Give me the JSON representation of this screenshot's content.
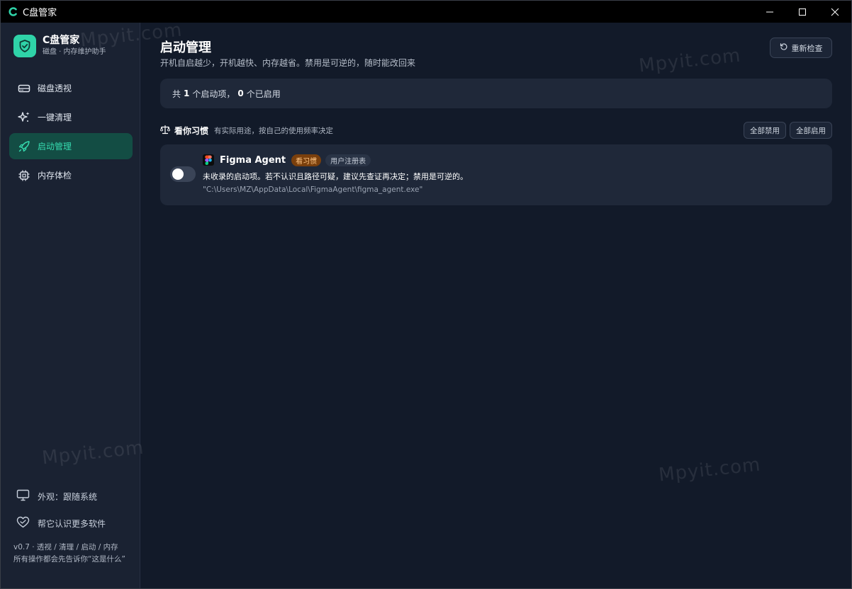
{
  "window": {
    "title": "C盘管家",
    "controls": [
      "minimize",
      "maximize",
      "close"
    ]
  },
  "brand": {
    "name": "C盘管家",
    "subtitle": "磁盘 · 内存维护助手",
    "accent": "#2fd3a8"
  },
  "sidebar": {
    "items": [
      {
        "label": "磁盘透视",
        "icon": "hard-drive-icon",
        "active": false
      },
      {
        "label": "一键清理",
        "icon": "sparkle-icon",
        "active": false
      },
      {
        "label": "启动管理",
        "icon": "rocket-icon",
        "active": true
      },
      {
        "label": "内存体检",
        "icon": "chip-icon",
        "active": false
      }
    ],
    "appearance_label": "外观：跟随系统",
    "contribute_label": "帮它认识更多软件",
    "version_text": "v0.7 · 透视 / 清理 / 启动 / 内存",
    "version_note": "所有操作都会先告诉你“这是什么”"
  },
  "page": {
    "title": "启动管理",
    "subtitle": "开机自启越少，开机越快、内存越省。禁用是可逆的，随时能改回来",
    "recheck_label": "重新检查"
  },
  "summary": {
    "prefix": "共",
    "total": "1",
    "mid": "个启动项，",
    "enabled": "0",
    "suffix": "个已启用"
  },
  "group": {
    "title": "看你习惯",
    "subtitle": "有实际用途，按自己的使用频率决定",
    "disable_all_label": "全部禁用",
    "enable_all_label": "全部启用"
  },
  "startup_items": [
    {
      "name": "Figma Agent",
      "tag": "看习惯",
      "source": "用户注册表",
      "description": "未收录的启动项。若不认识且路径可疑，建议先查证再决定；禁用是可逆的。",
      "path": "\"C:\\Users\\MZ\\AppData\\Local\\FigmaAgent\\figma_agent.exe\"",
      "enabled": false
    }
  ],
  "watermarks": [
    "Mpyit.com",
    "Mpyit.com",
    "Mpyit.com",
    "Mpyit.com"
  ]
}
